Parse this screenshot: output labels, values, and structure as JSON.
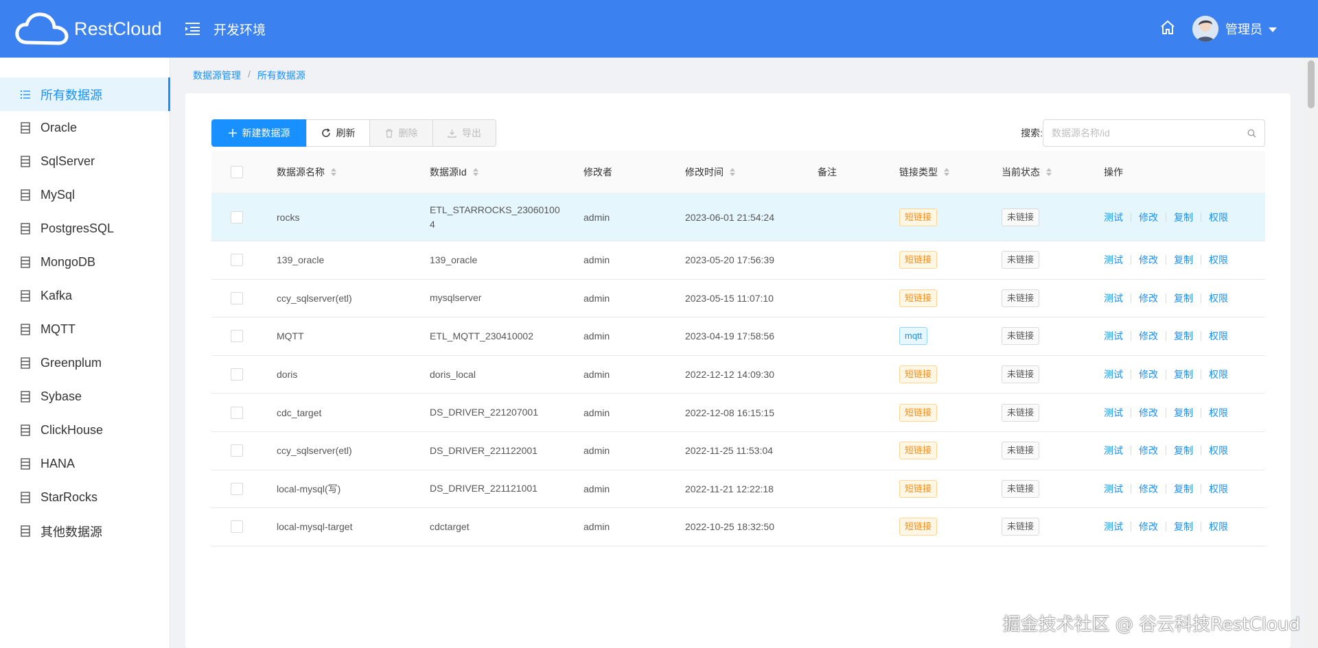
{
  "app": {
    "name": "RestCloud",
    "env": "开发环境",
    "user": "管理员"
  },
  "colors": {
    "header": "#3b82f0",
    "primary": "#1890ff",
    "short_tag": "#fa8c16"
  },
  "sidebar": {
    "items": [
      {
        "label": "所有数据源",
        "icon": "list-icon",
        "active": true
      },
      {
        "label": "Oracle",
        "icon": "doc-icon"
      },
      {
        "label": "SqlServer",
        "icon": "doc-icon"
      },
      {
        "label": "MySql",
        "icon": "doc-icon"
      },
      {
        "label": "PostgresSQL",
        "icon": "doc-icon"
      },
      {
        "label": "MongoDB",
        "icon": "doc-icon"
      },
      {
        "label": "Kafka",
        "icon": "doc-icon"
      },
      {
        "label": "MQTT",
        "icon": "doc-icon"
      },
      {
        "label": "Greenplum",
        "icon": "doc-icon"
      },
      {
        "label": "Sybase",
        "icon": "doc-icon"
      },
      {
        "label": "ClickHouse",
        "icon": "doc-icon"
      },
      {
        "label": "HANA",
        "icon": "doc-icon"
      },
      {
        "label": "StarRocks",
        "icon": "doc-icon"
      },
      {
        "label": "其他数据源",
        "icon": "doc-icon"
      }
    ]
  },
  "breadcrumb": {
    "parent": "数据源管理",
    "sep": "/",
    "current": "所有数据源"
  },
  "toolbar": {
    "new": "新建数据源",
    "refresh": "刷新",
    "delete": "删除",
    "export": "导出"
  },
  "search": {
    "label": "搜索:",
    "placeholder": "数据源名称/id"
  },
  "table": {
    "headers": {
      "name": "数据源名称",
      "id": "数据源Id",
      "modifier": "修改者",
      "time": "修改时间",
      "note": "备注",
      "type": "链接类型",
      "status": "当前状态",
      "ops": "操作"
    },
    "ops": {
      "test": "测试",
      "edit": "修改",
      "copy": "复制",
      "perm": "权限"
    },
    "rows": [
      {
        "name": "rocks",
        "id": "ETL_STARROCKS_23060100\n4",
        "modifier": "admin",
        "time": "2023-06-01 21:54:24",
        "note": "",
        "type": "短链接",
        "type_kind": "short",
        "status": "未链接",
        "selected": true
      },
      {
        "name": "139_oracle",
        "id": "139_oracle",
        "modifier": "admin",
        "time": "2023-05-20 17:56:39",
        "note": "",
        "type": "短链接",
        "type_kind": "short",
        "status": "未链接"
      },
      {
        "name": "ccy_sqlserver(etl)",
        "id": "mysqlserver",
        "modifier": "admin",
        "time": "2023-05-15 11:07:10",
        "note": "",
        "type": "短链接",
        "type_kind": "short",
        "status": "未链接"
      },
      {
        "name": "MQTT",
        "id": "ETL_MQTT_230410002",
        "modifier": "admin",
        "time": "2023-04-19 17:58:56",
        "note": "",
        "type": "mqtt",
        "type_kind": "mqtt",
        "status": "未链接"
      },
      {
        "name": "doris",
        "id": "doris_local",
        "modifier": "admin",
        "time": "2022-12-12 14:09:30",
        "note": "",
        "type": "短链接",
        "type_kind": "short",
        "status": "未链接"
      },
      {
        "name": "cdc_target",
        "id": "DS_DRIVER_221207001",
        "modifier": "admin",
        "time": "2022-12-08 16:15:15",
        "note": "",
        "type": "短链接",
        "type_kind": "short",
        "status": "未链接"
      },
      {
        "name": "ccy_sqlserver(etl)",
        "id": "DS_DRIVER_221122001",
        "modifier": "admin",
        "time": "2022-11-25 11:53:04",
        "note": "",
        "type": "短链接",
        "type_kind": "short",
        "status": "未链接"
      },
      {
        "name": "local-mysql(写)",
        "id": "DS_DRIVER_221121001",
        "modifier": "admin",
        "time": "2022-11-21 12:22:18",
        "note": "",
        "type": "短链接",
        "type_kind": "short",
        "status": "未链接"
      },
      {
        "name": "local-mysql-target",
        "id": "cdctarget",
        "modifier": "admin",
        "time": "2022-10-25 18:32:50",
        "note": "",
        "type": "短链接",
        "type_kind": "short",
        "status": "未链接"
      }
    ]
  },
  "watermark": "掘金技术社区 @ 谷云科技RestCloud"
}
